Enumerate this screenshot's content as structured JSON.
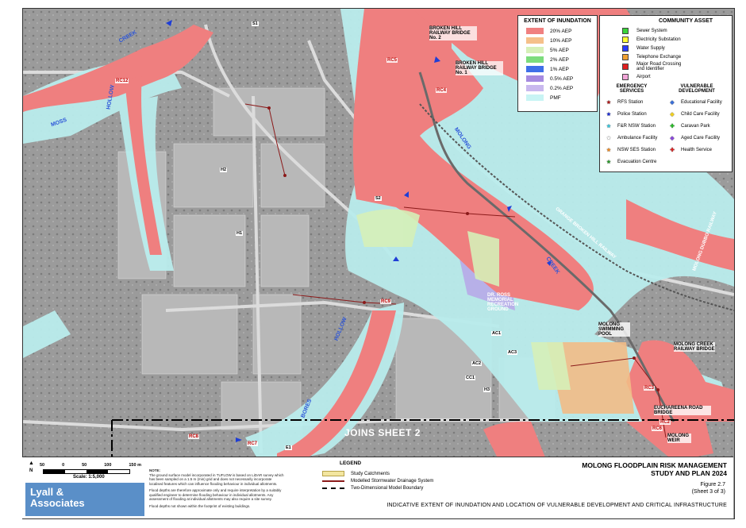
{
  "title_line1": "MOLONG FLOODPLAIN RISK MANAGEMENT",
  "title_line2": "STUDY AND PLAN 2024",
  "figure": "Figure 2.7",
  "sheet": "(Sheet 3 of 3)",
  "caption": "INDICATIVE EXTENT OF INUNDATION AND LOCATION OF VULNERABLE DEVELOPMENT AND CRITICAL INFRASTRUCTURE",
  "joins_sheet": "JOINS SHEET 2",
  "logo": {
    "line1": "Lyall &",
    "line2": "Associates"
  },
  "scale": {
    "ticks": [
      "50",
      "0",
      "50",
      "100",
      "150 m"
    ],
    "label": "Scale: 1:5,000",
    "north": "N"
  },
  "note": {
    "title": "NOTE:",
    "p1": "The ground surface model incorporated in TUFLOW is based on LiDAR survey which has been sampled on a 1.5 m (min) grid and does not necessarily incorporate localised features which can influence flooding behaviour in individual allotments.",
    "p2": "Flood depths are therefore approximate only and require interpretation by a suitably qualified engineer to determine flooding behaviour in individual allotments. Any assessment of flooding at individual allotments may also require a site survey.",
    "p3": "Flood depths not shown within the footprint of existing buildings."
  },
  "legend": {
    "title": "LEGEND",
    "items": [
      "Study Catchments",
      "Modelled Stormwater Drainage System",
      "Two-Dimensional Model Boundary"
    ]
  },
  "inundation": {
    "title": "EXTENT OF INUNDATION",
    "items": [
      {
        "label": "20% AEP",
        "color": "#f08080"
      },
      {
        "label": "10% AEP",
        "color": "#f5c08a"
      },
      {
        "label": "5% AEP",
        "color": "#d6f0b8"
      },
      {
        "label": "2% AEP",
        "color": "#7ddc7d"
      },
      {
        "label": "1% AEP",
        "color": "#3f6fe8"
      },
      {
        "label": "0.5% AEP",
        "color": "#a68ae0"
      },
      {
        "label": "0.2% AEP",
        "color": "#c9b8ee"
      },
      {
        "label": "PMF",
        "color": "#c8f4f4"
      }
    ]
  },
  "community": {
    "title": "COMMUNITY ASSET",
    "items": [
      {
        "label": "Sewer System",
        "color": "#39d339"
      },
      {
        "label": "Electricity Substation",
        "color": "#ffff33"
      },
      {
        "label": "Water Supply",
        "color": "#2a3cff"
      },
      {
        "label": "Telephone Exchange",
        "color": "#f0a030"
      },
      {
        "label": "Major Road Crossing",
        "label2": "and Identifier",
        "color": "#e02020"
      },
      {
        "label": "Airport",
        "color": "#f3a6d9"
      }
    ],
    "emergency_title": "EMERGENCY SERVICES",
    "emergency": [
      {
        "label": "RFS Station",
        "icon": "star-icon",
        "color": "#b01818"
      },
      {
        "label": "Police Station",
        "icon": "star-icon",
        "color": "#1a2ad8"
      },
      {
        "label": "F&R NSW Station",
        "icon": "star-icon",
        "color": "#33c9e0"
      },
      {
        "label": "Ambulance Facility",
        "icon": "star-icon",
        "color": "#ffffff"
      },
      {
        "label": "NSW SES Station",
        "icon": "star-icon",
        "color": "#f08a20"
      },
      {
        "label": "Evacuation Centre",
        "icon": "star-icon",
        "color": "#2a9a2a"
      }
    ],
    "vulnerable_title": "VULNERABLE DEVELOPMENT",
    "vulnerable": [
      {
        "label": "Educational Facility",
        "icon": "diamond-icon",
        "color": "#3a6fd8"
      },
      {
        "label": "Child Care Facility",
        "icon": "diamond-icon",
        "color": "#f0d020"
      },
      {
        "label": "Caravan Park",
        "icon": "cross-icon",
        "color": "#20c020"
      },
      {
        "label": "Aged Care Facility",
        "icon": "diamond-icon",
        "color": "#8a4ad8"
      },
      {
        "label": "Health Service",
        "icon": "cross-diamond-icon",
        "color": "#e02020"
      }
    ]
  },
  "crossings": [
    "RC5",
    "RC4",
    "RC12",
    "RC9",
    "RC8",
    "RC7",
    "RC6",
    "RC3",
    "RC2"
  ],
  "tags": [
    "S1",
    "S2",
    "H2",
    "H1",
    "AC1",
    "AC2",
    "AC3",
    "CC1",
    "H3",
    "E1"
  ],
  "labels": {
    "bhr2": "BROKEN HILL RAILWAY BRIDGE No. 2",
    "bhr1": "BROKEN HILL RAILWAY BRIDGE No. 1",
    "creek_a": "CREEK",
    "hollow_a": "HOLLOW",
    "moss": "MOSS",
    "molong": "MOLONG",
    "creek_b": "CREEK",
    "hollow_b": "HOLLOW",
    "bores": "BORES",
    "orange_rail": "ORANGE BROKEN HILL RAILWAY",
    "molong_dubbo": "MOLONG DUBBO RAILWAY",
    "ross": "DR. ROSS MEMORIAL RECREATION GROUND",
    "pool": "MOLONG SWIMMING POOL",
    "creek_rail": "MOLONG CREEK RAILWAY BRIDGE",
    "euch_bridge": "EUCHAREENA ROAD BRIDGE",
    "weir": "MOLONG WEIR"
  }
}
